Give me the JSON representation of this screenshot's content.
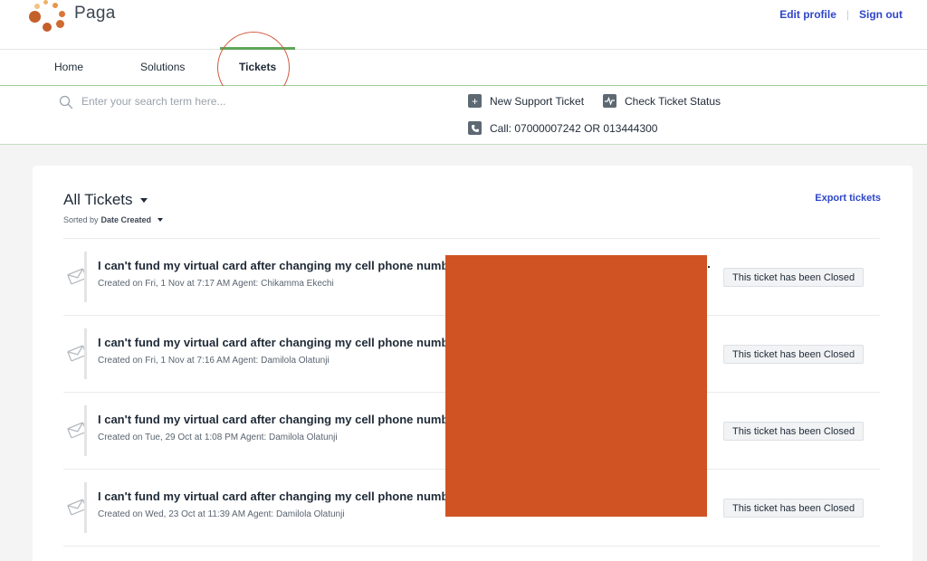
{
  "brand": {
    "name": "Paga",
    "colors": {
      "dot_dark": "#c4602a",
      "dot_light": "#f0b267"
    }
  },
  "header": {
    "edit_profile": "Edit profile",
    "sign_out": "Sign out"
  },
  "nav": {
    "items": [
      "Home",
      "Solutions",
      "Tickets"
    ],
    "active": "Tickets"
  },
  "subbar": {
    "search_placeholder": "Enter your search term here...",
    "new_ticket": "New Support Ticket",
    "check_status": "Check Ticket Status",
    "call": "Call: 07000007242 OR 013444300"
  },
  "tickets_panel": {
    "title": "All Tickets",
    "sorted_by_label": "Sorted by",
    "sorted_by_value": "Date Created",
    "export": "Export tickets"
  },
  "tickets": [
    {
      "subject": "I can't fund my virtual card after changing my cell phone number",
      "meta": "Created on Fri, 1 Nov at 7:17 AM Agent: Chikamma Ekechi",
      "status": "This ticket has been Closed"
    },
    {
      "subject": "I can't fund my virtual card after changing my cell phone number",
      "meta": "Created on Fri, 1 Nov at 7:16 AM Agent: Damilola Olatunji",
      "status": "This ticket has been Closed"
    },
    {
      "subject": "I can't fund my virtual card after changing my cell phone number",
      "meta": "Created on Tue, 29 Oct at 1:08 PM Agent: Damilola Olatunji",
      "status": "This ticket has been Closed"
    },
    {
      "subject": "I can't fund my virtual card after changing my cell phone number",
      "meta": "Created on Wed, 23 Oct at 11:39 AM Agent: Damilola Olatunji",
      "status": "This ticket has been Closed"
    }
  ],
  "annotations": {
    "redaction_color": "#d05324",
    "highlight_circle_color": "#d35a3e"
  }
}
